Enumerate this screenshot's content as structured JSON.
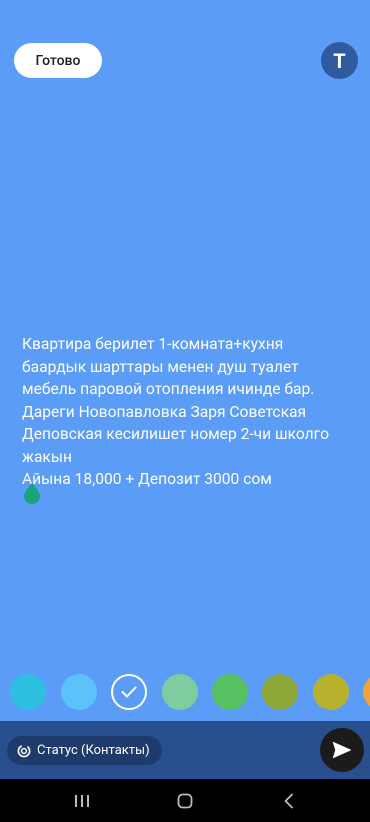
{
  "header": {
    "done_label": "Готово",
    "text_tool_label": "T"
  },
  "status": {
    "text": "Квартира берилет 1-комната+кухня\nбаардык шарттары менен душ туалет\nмебель паровой отопления ичинде бар.\nДареги Новопавловка Заря Советская\nДеповская кесилишет номер 2-чи школго\nжакын\nАйына 18,000 + Депозит 3000 сом",
    "background_color": "#5b9cf7"
  },
  "palette": {
    "colors": [
      "#2ec0e0",
      "#5cc3fa",
      "#5b9cf7",
      "#7fcca0",
      "#58c262",
      "#8fa83a",
      "#b7b22d",
      "#f0a33a"
    ],
    "selected_index": 2
  },
  "footer": {
    "audience_label": "Статус (Контакты)"
  }
}
